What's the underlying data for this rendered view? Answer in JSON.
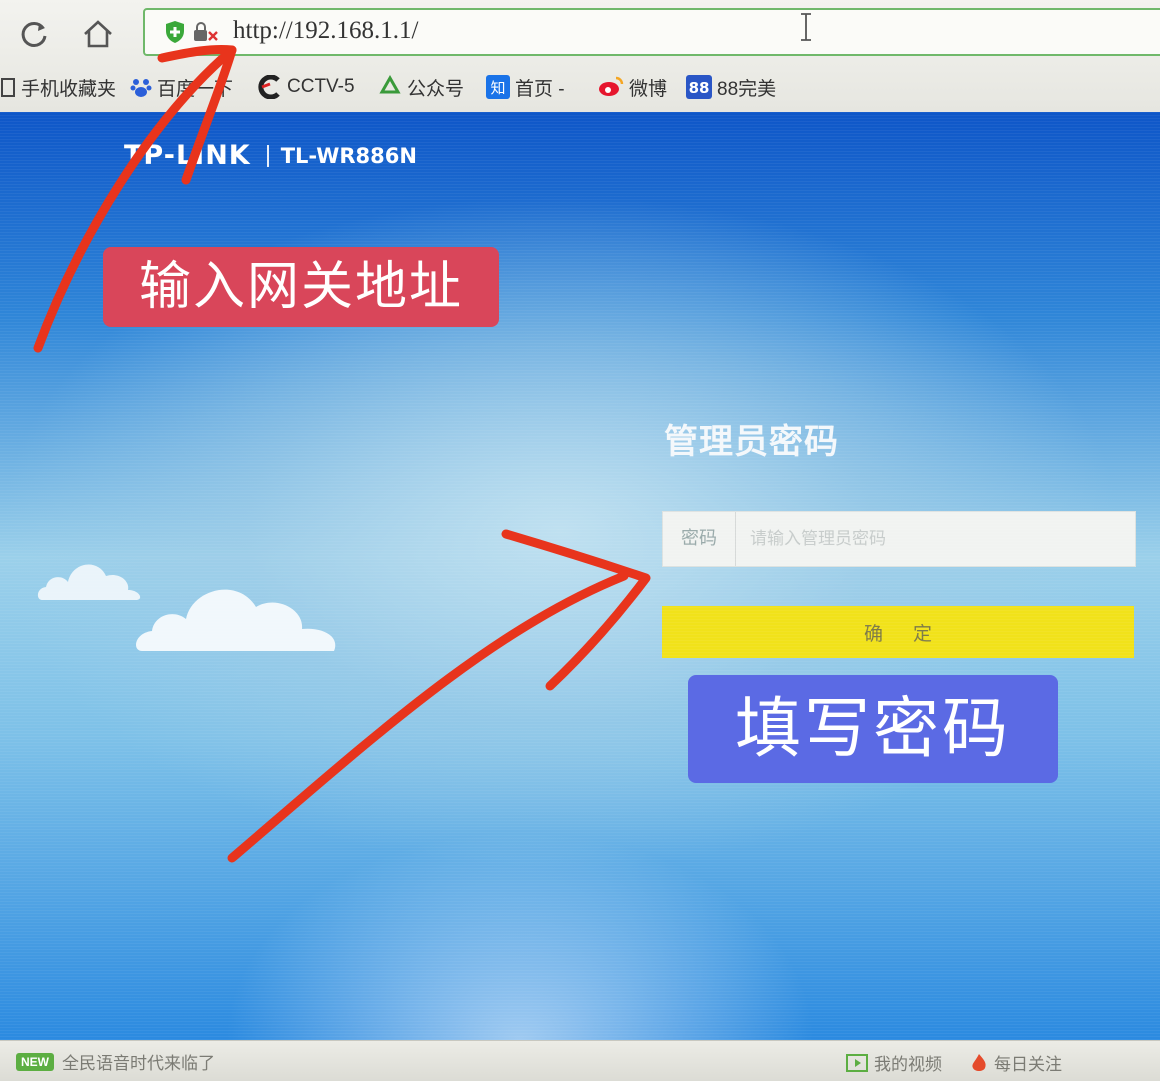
{
  "browser": {
    "url": "http://192.168.1.1/",
    "bookmarks": [
      {
        "label": "手机收藏夹",
        "icon": "folder-icon"
      },
      {
        "label": "百度一下",
        "icon": "baidu-paw-icon"
      },
      {
        "label": "CCTV-5",
        "icon": "cctv-icon"
      },
      {
        "label": "公众号",
        "icon": "recycle-icon"
      },
      {
        "label": "首页 -",
        "icon": "zhihu-icon"
      },
      {
        "label": "微博",
        "icon": "weibo-icon"
      },
      {
        "label": "88完美",
        "icon": "88-icon"
      }
    ]
  },
  "router_page": {
    "brand": "TP-LINK",
    "model": "TL-WR886N",
    "login_title": "管理员密码",
    "password_label": "密码",
    "password_placeholder": "请输入管理员密码",
    "confirm_label": "确定"
  },
  "annotations": {
    "gateway_tag": "输入网关地址",
    "password_tag": "填写密码",
    "arrow_color": "#e8341c"
  },
  "statusbar": {
    "left_text": "全民语音时代来临了",
    "video": "我的视频",
    "follow": "每日关注"
  }
}
